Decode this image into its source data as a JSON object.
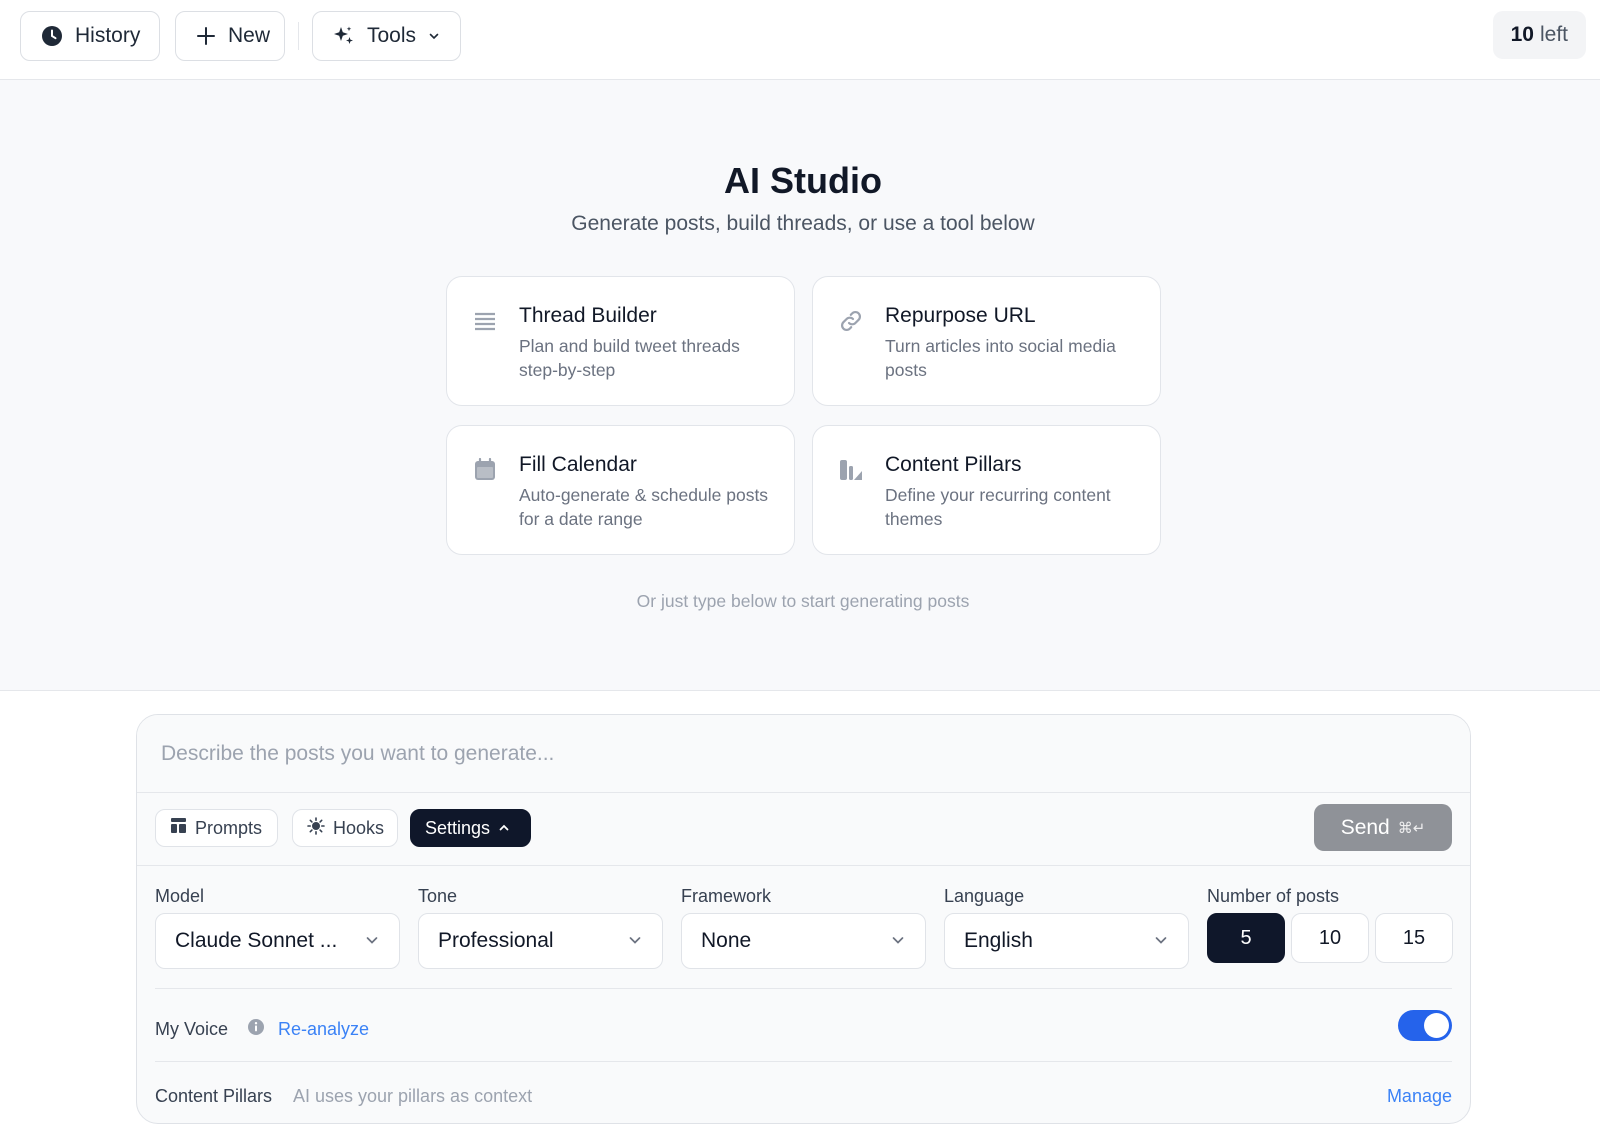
{
  "topbar": {
    "history_label": "History",
    "new_label": "New",
    "tools_label": "Tools",
    "quota_count": "10",
    "quota_suffix": "left"
  },
  "hero": {
    "title": "AI Studio",
    "subtitle": "Generate posts, build threads, or use a tool below",
    "hint": "Or just type below to start generating posts"
  },
  "tools": [
    {
      "title": "Thread Builder",
      "desc": "Plan and build tweet threads step-by-step",
      "icon": "list-icon"
    },
    {
      "title": "Repurpose URL",
      "desc": "Turn articles into social media posts",
      "icon": "link-icon"
    },
    {
      "title": "Fill Calendar",
      "desc": "Auto-generate & schedule posts for a date range",
      "icon": "calendar-icon"
    },
    {
      "title": "Content Pillars",
      "desc": "Define your recurring content themes",
      "icon": "pillars-icon"
    }
  ],
  "composer": {
    "placeholder": "Describe the posts you want to generate...",
    "prompts_label": "Prompts",
    "hooks_label": "Hooks",
    "settings_label": "Settings",
    "send_label": "Send",
    "send_shortcut": "⌘↵"
  },
  "settings": {
    "model_label": "Model",
    "model_value": "Claude Sonnet ...",
    "tone_label": "Tone",
    "tone_value": "Professional",
    "framework_label": "Framework",
    "framework_value": "None",
    "language_label": "Language",
    "language_value": "English",
    "posts_label": "Number of posts",
    "post_counts": [
      "5",
      "10",
      "15"
    ],
    "selected_count": "5"
  },
  "voice": {
    "label": "My Voice",
    "reanalyze_label": "Re-analyze",
    "enabled": true
  },
  "pillars": {
    "label": "Content Pillars",
    "sub": "AI uses your pillars as context",
    "manage_label": "Manage"
  },
  "colors": {
    "accent": "#2563eb",
    "link": "#3b82f6",
    "dark": "#0f172a",
    "send_disabled": "#8f9298"
  }
}
